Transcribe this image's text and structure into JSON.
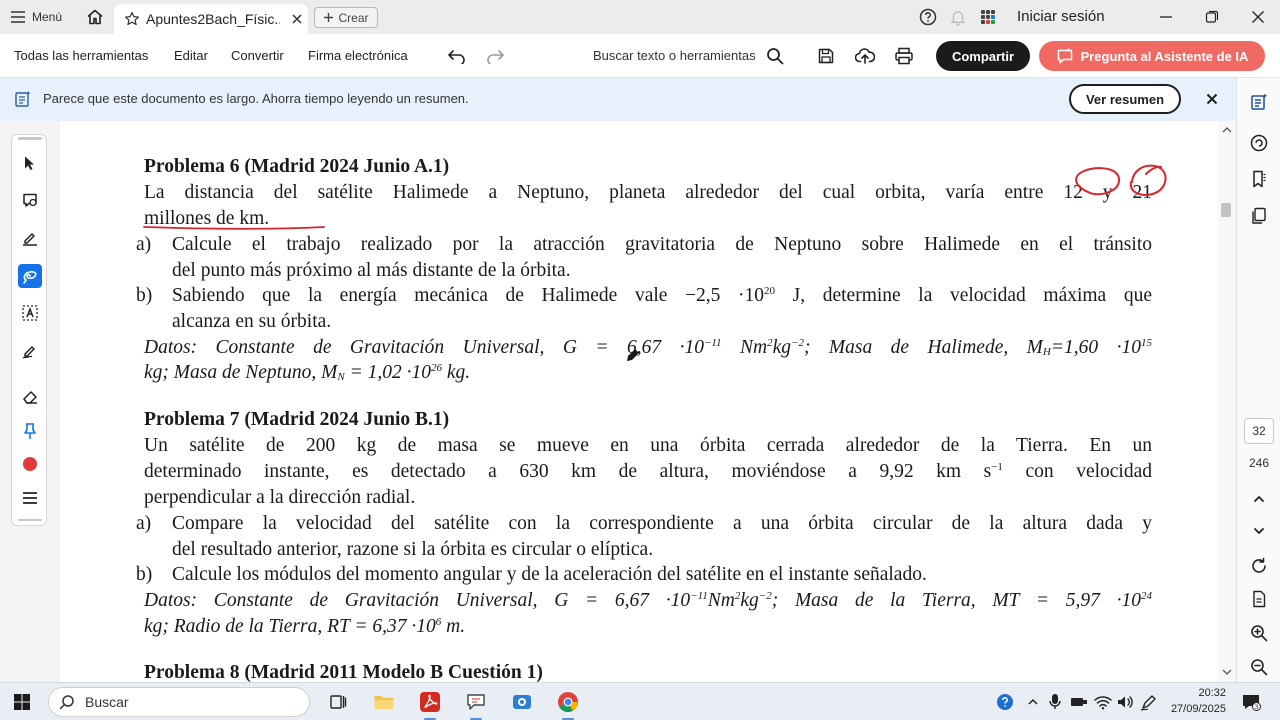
{
  "titlebar": {
    "menu_label": "Menú",
    "tab_title": "Apuntes2Bach_Físic...",
    "create_label": "Crear",
    "signin_label": "Iniciar sesión"
  },
  "toolbar": {
    "all_tools": "Todas las herramientas",
    "edit": "Editar",
    "convert": "Convertir",
    "esign": "Firma electrónica",
    "search_placeholder": "Buscar texto o herramientas",
    "share_label": "Compartir",
    "ai_label": "Pregunta al Asistente de IA"
  },
  "banner": {
    "text": "Parece que este documento es largo. Ahorra tiempo leyendo un resumen.",
    "button": "Ver resumen"
  },
  "page_nav": {
    "current": "32",
    "total": "246"
  },
  "document": {
    "p6": {
      "heading": "Problema 6 (Madrid 2024 Junio A.1)",
      "intro1": "La distancia del satélite Halimede a Neptuno, planeta alrededor del cual orbita, varía entre 12 y 21",
      "intro2": "millones de km.",
      "a_label": "a)",
      "a1": "Calcule el trabajo realizado por la atracción gravitatoria de Neptuno sobre Halimede en el tránsito",
      "a2": "del punto más próximo al más distante de la órbita.",
      "b_label": "b)",
      "b1_pre": "Sabiendo que la energía mecánica de Halimede vale −2,5 ·10",
      "b1_exp": "20",
      "b1_post": " J, determine la velocidad máxima que",
      "b2": "alcanza en su órbita.",
      "d1_pre": "Datos: Constante de Gravitación Universal, G = 6,67 ·10",
      "d1_exp1": "−11",
      "d1_mid": " Nm",
      "d1_exp2": "2",
      "d1_mid2": "kg",
      "d1_exp3": "−2",
      "d1_mid3": "; Masa de Halimede, M",
      "d1_sub": "H",
      "d1_mid4": "=1,60 ·10",
      "d1_exp4": "15",
      "d2_pre": "kg; Masa de Neptuno, M",
      "d2_sub": "N",
      "d2_mid": " = 1,02 ·10",
      "d2_exp": "26",
      "d2_post": " kg."
    },
    "p7": {
      "heading": "Problema 7 (Madrid 2024 Junio B.1)",
      "intro1": "Un satélite de 200 kg de masa se mueve en una órbita cerrada alrededor de la Tierra. En un",
      "intro2_pre": "determinado instante, es detectado a 630 km de altura, moviéndose a 9,92 km s",
      "intro2_exp": "−1",
      "intro2_post": " con velocidad",
      "intro3": "perpendicular a la dirección radial.",
      "a_label": "a)",
      "a1": "Compare la velocidad del satélite con la correspondiente a una órbita circular de la altura dada y",
      "a2": "del resultado anterior, razone si la órbita es circular o elíptica.",
      "b_label": "b)",
      "b1": "Calcule los módulos del momento angular y de la aceleración del satélite en el instante señalado.",
      "d1_pre": "Datos: Constante de Gravitación Universal, G = 6,67 ·10",
      "d1_exp1": "−11",
      "d1_mid": "Nm",
      "d1_exp2": "2",
      "d1_mid2": "kg",
      "d1_exp3": "−2",
      "d1_mid3": "; Masa de la Tierra, MT = 5,97 ·10",
      "d1_exp4": "24",
      "d2_pre": "kg; Radio de la Tierra, RT = 6,37 ·10",
      "d2_exp": "6",
      "d2_post": " m."
    },
    "p8": {
      "heading": "Problema 8 (Madrid 2011 Modelo B Cuestión 1)"
    }
  },
  "taskbar": {
    "search_label": "Buscar",
    "time": "20:32",
    "date": "27/09/2025"
  },
  "colors": {
    "accent": "#1473e6",
    "ai_button": "#f06a63",
    "ink": "#d7262e",
    "record_red": "#e03a3a"
  },
  "icons": [
    "hamburger-icon",
    "home-icon",
    "star-icon",
    "close-icon",
    "plus-icon",
    "help-icon",
    "bell-icon",
    "apps-grid-icon",
    "minimize-icon",
    "maximize-icon",
    "undo-icon",
    "redo-icon",
    "search-icon",
    "save-icon",
    "upload-cloud-icon",
    "print-icon",
    "ai-assistant-icon",
    "summary-icon",
    "select-cursor-icon",
    "comment-icon",
    "highlight-pen-icon",
    "draw-lasso-icon",
    "text-select-icon",
    "fill-sign-icon",
    "eraser-icon",
    "pin-icon",
    "record-dot-icon",
    "menu-lines-icon",
    "copy-icon",
    "bookmark-icon",
    "pages-icon",
    "chevron-up-icon",
    "chevron-down-icon",
    "refresh-icon",
    "file-icon",
    "zoom-in-icon",
    "zoom-out-icon",
    "windows-start-icon",
    "task-view-icon",
    "folder-icon",
    "pdf-app-icon",
    "chat-app-icon",
    "camera-app-icon",
    "chrome-icon",
    "wifi-icon",
    "volume-icon",
    "notification-icon"
  ]
}
